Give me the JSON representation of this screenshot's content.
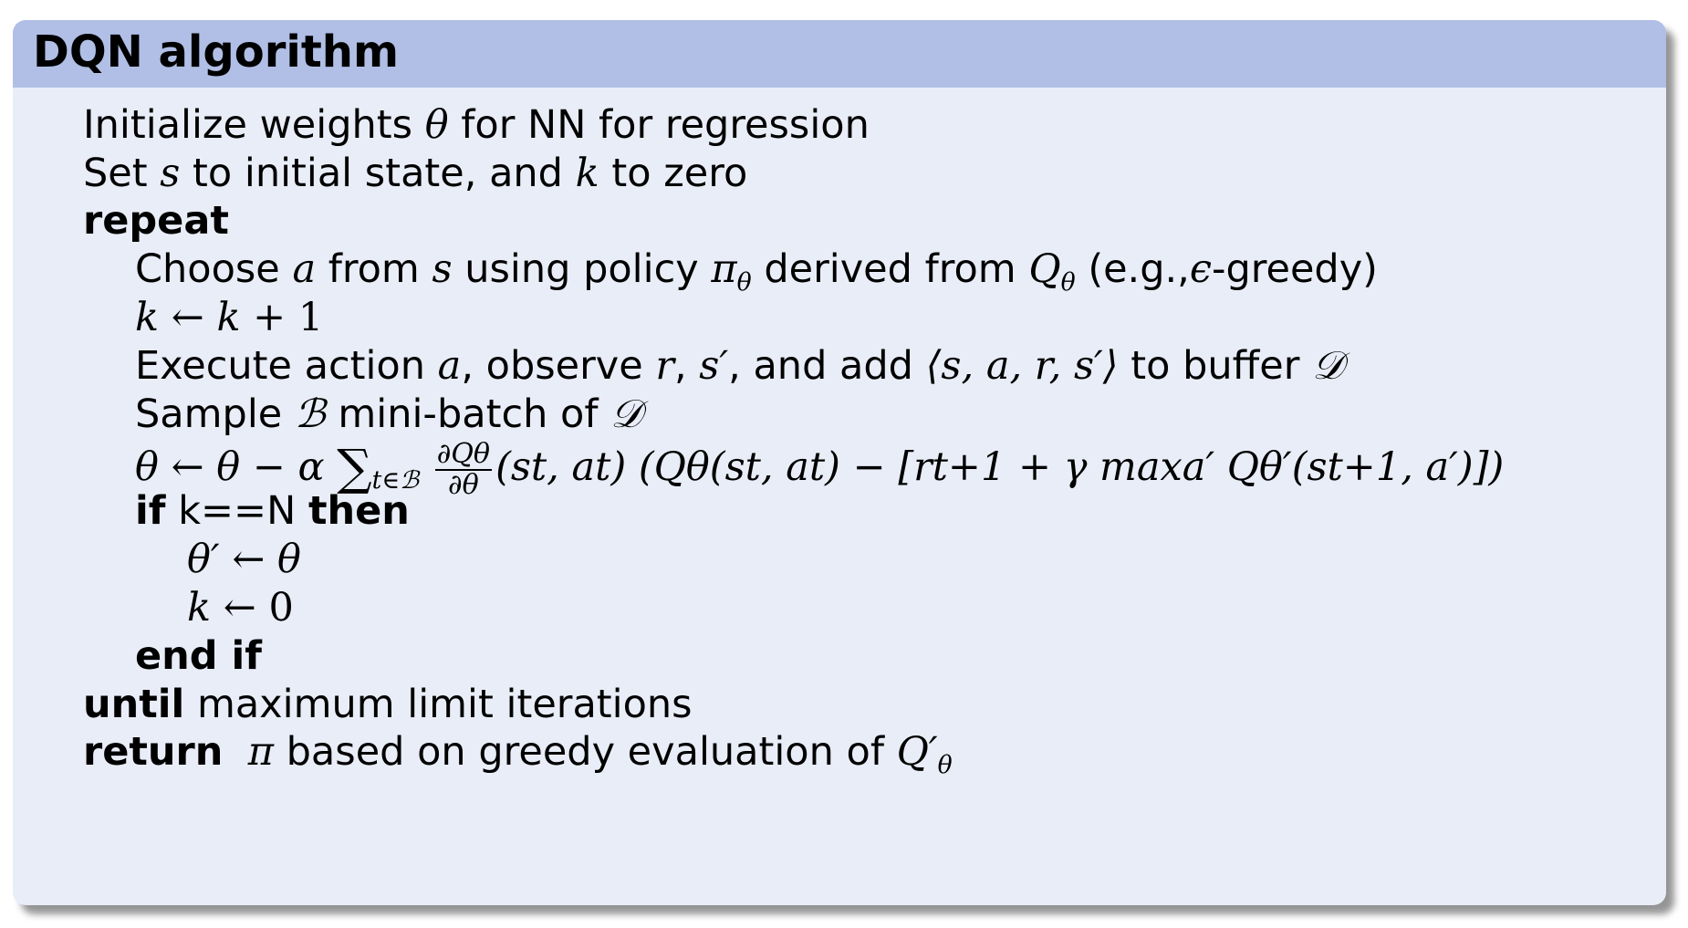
{
  "title": "DQN algorithm",
  "lines": {
    "l1": "Initialize weights θ for NN for regression",
    "l2": "Set s to initial state, and k to zero",
    "l3": "repeat",
    "l4": "Choose a from s using policy πθ derived from Qθ (e.g., ϵ-greedy)",
    "l5": "k ← k + 1",
    "l6": "Execute action a, observe r, s′, and add ⟨s, a, r, s′⟩ to buffer 𝒟",
    "l7": "Sample ℬ mini-batch of 𝒟",
    "l8": "θ ← θ − α ∑t∈ℬ ∂Qθ/∂θ (st, at) (Qθ(st, at) − [rt+1 + γ maxa′ Qθ′(st+1, a′)])",
    "l9": "if k==N then",
    "l10": "θ′ ← θ",
    "l11": "k ← 0",
    "l12": "end if",
    "l13": "until maximum limit iterations",
    "l14": "return π based on greedy evaluation of Q′θ"
  },
  "tokens": {
    "initialize": "Initialize weights",
    "theta": "θ",
    "for_nn": "for NN for regression",
    "set": "Set",
    "s": "s",
    "to_initial": "to initial state, and",
    "k": "k",
    "to_zero": "to zero",
    "repeat": "repeat",
    "choose": "Choose",
    "a": "a",
    "from": "from",
    "using_policy": "using policy",
    "pi": "π",
    "derived_from": "derived from",
    "Q": "Q",
    "eg_open": "(e.g.,",
    "epsilon": "ϵ",
    "greedy_close": "-greedy)",
    "arrow": "←",
    "plus_one": "+ 1",
    "execute": "Execute action",
    "observe": ", observe",
    "r": "r",
    "s_prime": "s′",
    "and_add": ", and add",
    "tuple": "⟨s, a, r, s′⟩",
    "to_buffer": "to buffer",
    "D": "𝒟",
    "sample": "Sample",
    "B": "ℬ",
    "minibatch_of": "mini-batch of",
    "minus": "−",
    "alpha": "α",
    "sum": "∑",
    "sum_sub": "t∈ℬ",
    "frac_num": "∂Qθ",
    "frac_den": "∂θ",
    "st_at": "(st, at)",
    "big_term": "(Qθ(st, at) − [rt+1 + γ maxa′ Qθ′(st+1, a′)])",
    "if": "if",
    "k_eq_n": "k==N",
    "then": "then",
    "theta_prime": "θ′",
    "zero": "0",
    "end_if": "end if",
    "until": "until",
    "max_limit": "maximum limit iterations",
    "return": "return",
    "based_on": "based on greedy evaluation of",
    "Q_prime": "Q′"
  }
}
